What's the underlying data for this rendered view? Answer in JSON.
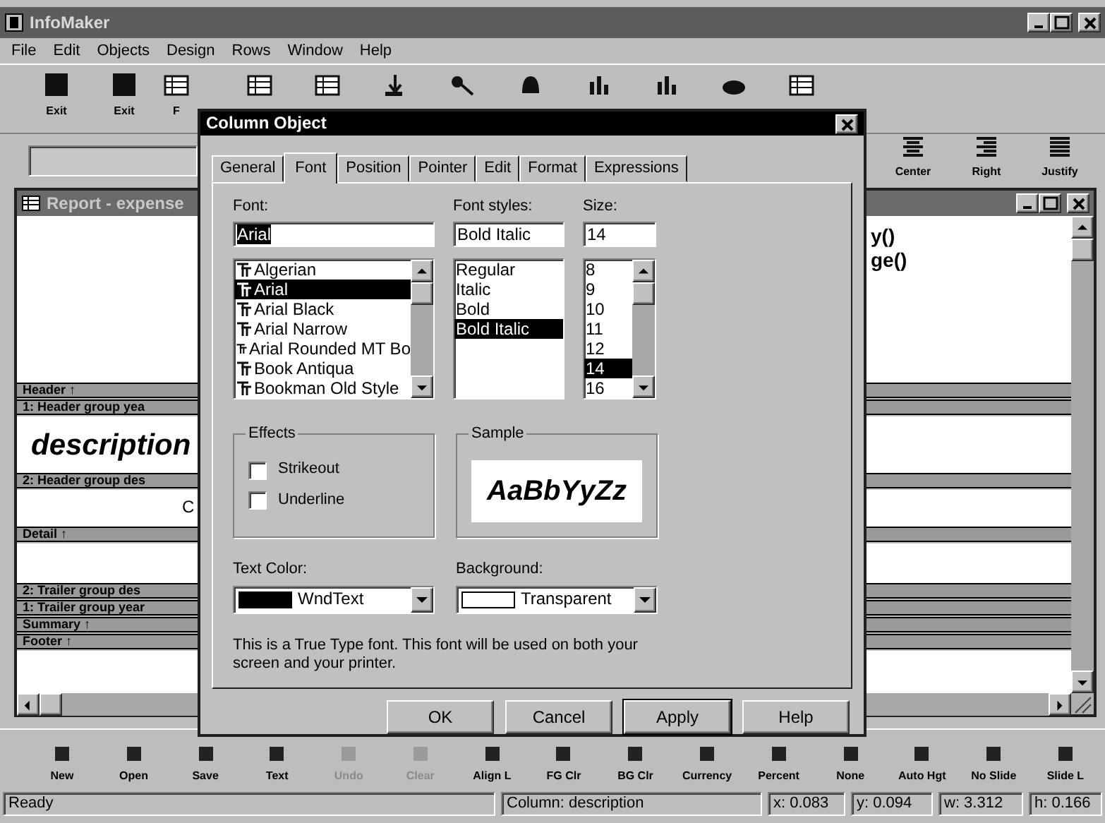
{
  "window": {
    "title": "InfoMaker"
  },
  "menu": [
    {
      "label": "File"
    },
    {
      "label": "Edit"
    },
    {
      "label": "Objects"
    },
    {
      "label": "Design"
    },
    {
      "label": "Rows"
    },
    {
      "label": "Window"
    },
    {
      "label": "Help"
    }
  ],
  "toolbar": [
    {
      "label": "Exit"
    },
    {
      "label": "Exit"
    },
    {
      "label": "F"
    }
  ],
  "format_toolbar": [
    {
      "label": "Center"
    },
    {
      "label": "Right"
    },
    {
      "label": "Justify"
    }
  ],
  "report": {
    "title": "Report - expense",
    "sections": [
      {
        "kind": "area",
        "right_lines": [
          "y()",
          "ge()"
        ]
      },
      {
        "kind": "band",
        "label": "Header ↑"
      },
      {
        "kind": "band",
        "label": "1: Header group yea"
      },
      {
        "kind": "area",
        "left_text": "description"
      },
      {
        "kind": "band",
        "label": "2: Header group des"
      },
      {
        "kind": "area",
        "edge_text": "C"
      },
      {
        "kind": "band",
        "label": "Detail ↑"
      },
      {
        "kind": "area"
      },
      {
        "kind": "band",
        "label": "2: Trailer group des"
      },
      {
        "kind": "band",
        "label": "1: Trailer group year"
      },
      {
        "kind": "band",
        "label": "Summary ↑"
      },
      {
        "kind": "band",
        "label": "Footer ↑"
      },
      {
        "kind": "area"
      }
    ]
  },
  "dialog": {
    "title": "Column Object",
    "tabs": [
      {
        "label": "General",
        "selected": false
      },
      {
        "label": "Font",
        "selected": true
      },
      {
        "label": "Position",
        "selected": false
      },
      {
        "label": "Pointer",
        "selected": false
      },
      {
        "label": "Edit",
        "selected": false
      },
      {
        "label": "Format",
        "selected": false
      },
      {
        "label": "Expressions",
        "selected": false
      }
    ],
    "font": {
      "label": "Font:",
      "value": "Arial",
      "value_selected": true,
      "items": [
        {
          "label": "Algerian",
          "selected": false
        },
        {
          "label": "Arial",
          "selected": true
        },
        {
          "label": "Arial Black",
          "selected": false
        },
        {
          "label": "Arial Narrow",
          "selected": false
        },
        {
          "label": "Arial Rounded MT Bo",
          "selected": false
        },
        {
          "label": "Book Antiqua",
          "selected": false
        },
        {
          "label": "Bookman Old Style",
          "selected": false
        }
      ]
    },
    "style": {
      "label": "Font styles:",
      "value": "Bold Italic",
      "items": [
        {
          "label": "Regular",
          "selected": false
        },
        {
          "label": "Italic",
          "selected": false
        },
        {
          "label": "Bold",
          "selected": false
        },
        {
          "label": "Bold Italic",
          "selected": true
        }
      ]
    },
    "size": {
      "label": "Size:",
      "value": "14",
      "items": [
        {
          "label": "8",
          "selected": false
        },
        {
          "label": "9",
          "selected": false
        },
        {
          "label": "10",
          "selected": false
        },
        {
          "label": "11",
          "selected": false
        },
        {
          "label": "12",
          "selected": false
        },
        {
          "label": "14",
          "selected": true
        },
        {
          "label": "16",
          "selected": false
        }
      ]
    },
    "effects": {
      "title": "Effects",
      "options": [
        {
          "label": "Strikeout",
          "checked": false
        },
        {
          "label": "Underline",
          "checked": false
        }
      ]
    },
    "sample": {
      "title": "Sample",
      "text": "AaBbYyZz"
    },
    "text_color": {
      "label": "Text Color:",
      "value": "WndText",
      "color": "#000000"
    },
    "background": {
      "label": "Background:",
      "value": "Transparent",
      "color": "#ffffff"
    },
    "note": "This is a True Type font. This font will be used on both your screen and your printer.",
    "buttons": [
      {
        "label": "OK",
        "default": false
      },
      {
        "label": "Cancel",
        "default": false
      },
      {
        "label": "Apply",
        "default": true
      },
      {
        "label": "Help",
        "default": false
      }
    ]
  },
  "bottom_toolbar": [
    {
      "label": "New",
      "disabled": false
    },
    {
      "label": "Open",
      "disabled": false
    },
    {
      "label": "Save",
      "disabled": false
    },
    {
      "label": "Text",
      "disabled": false
    },
    {
      "label": "Undo",
      "disabled": true
    },
    {
      "label": "Clear",
      "disabled": true
    },
    {
      "label": "Align L",
      "disabled": false
    },
    {
      "label": "FG Clr",
      "disabled": false
    },
    {
      "label": "BG Clr",
      "disabled": false
    },
    {
      "label": "Currency",
      "disabled": false
    },
    {
      "label": "Percent",
      "disabled": false
    },
    {
      "label": "None",
      "disabled": false
    },
    {
      "label": "Auto Hgt",
      "disabled": false
    },
    {
      "label": "No Slide",
      "disabled": false
    },
    {
      "label": "Slide L",
      "disabled": false
    }
  ],
  "status_bar": [
    "Ready",
    "Column: description",
    "x: 0.083",
    "y: 0.094",
    "w: 3.312",
    "h: 0.166"
  ]
}
